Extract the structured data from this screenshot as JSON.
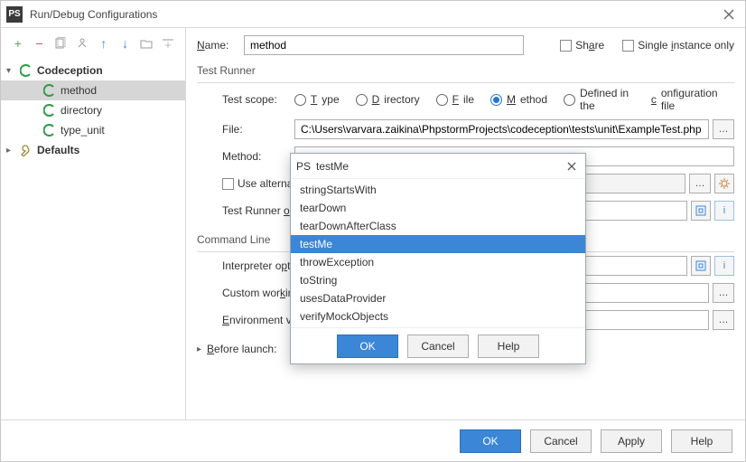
{
  "window": {
    "title": "Run/Debug Configurations"
  },
  "toolbar": {
    "name_label": "Name:",
    "name_value": "method",
    "share": "Share",
    "single_instance": "Single instance only"
  },
  "tree": {
    "root": "Codeception",
    "items": [
      "method",
      "directory",
      "type_unit"
    ],
    "defaults": "Defaults"
  },
  "testRunner": {
    "section": "Test Runner",
    "scope_label": "Test scope:",
    "scope_options": {
      "type": "Type",
      "directory": "Directory",
      "file": "File",
      "method": "Method",
      "defined": "Defined in the configuration file"
    },
    "selected_scope": "method",
    "file_label": "File:",
    "file_value": "C:\\Users\\varvara.zaikina\\PhpstormProjects\\codeception\\tests\\unit\\ExampleTest.php",
    "method_label": "Method:",
    "use_alt": "Use alternative configuration file",
    "runner_opts_label": "Test Runner options:"
  },
  "cmdLine": {
    "section": "Command Line",
    "interp_label": "Interpreter options:",
    "cwd_label": "Custom working directory:",
    "env_label": "Environment variables:"
  },
  "beforeLaunch": "Before launch:",
  "buttons": {
    "ok": "OK",
    "cancel": "Cancel",
    "apply": "Apply",
    "help": "Help"
  },
  "popup": {
    "title": "testMe",
    "items": [
      "stringStartsWith",
      "tearDown",
      "tearDownAfterClass",
      "testMe",
      "throwException",
      "toString",
      "usesDataProvider",
      "verifyMockObjects"
    ],
    "selected": "testMe",
    "ok": "OK",
    "cancel": "Cancel",
    "help": "Help"
  }
}
